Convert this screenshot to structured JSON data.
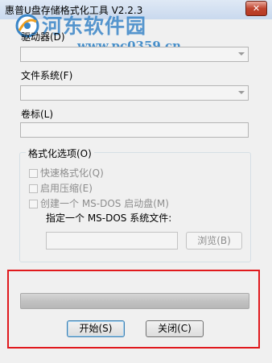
{
  "window": {
    "title": "惠普U盘存储格式化工具 V2.2.3",
    "close_glyph": "✕"
  },
  "watermark": {
    "title": "河东软件园",
    "url": "www.pc0359.cn",
    "logo_icon": "pc0359-logo"
  },
  "fields": {
    "drive_label": "驱动器(D)",
    "drive_value": "",
    "fs_label": "文件系统(F)",
    "fs_value": "",
    "volume_label": "卷标(L)",
    "volume_value": ""
  },
  "format_options": {
    "legend": "格式化选项(O)",
    "quick_format": "快速格式化(Q)",
    "enable_compression": "启用压缩(E)",
    "create_dos_disk": "创建一个 MS-DOS 启动盘(M)",
    "dos_file_label": "指定一个 MS-DOS 系统文件:",
    "dos_file_value": "",
    "browse_button": "浏览(B)"
  },
  "progress": {
    "value_percent": 0
  },
  "actions": {
    "start_button": "开始(S)",
    "close_button": "关闭(C)"
  },
  "colors": {
    "highlight_box": "#e0191d",
    "watermark_blue": "#3a86c8"
  }
}
